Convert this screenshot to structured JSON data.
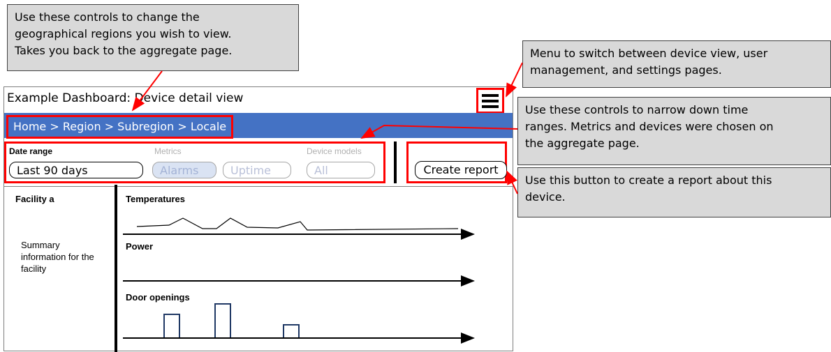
{
  "callouts": {
    "regions": [
      "Use these controls to change the",
      "geographical regions you wish to view.",
      "Takes you back to the aggregate page."
    ],
    "menu": [
      "Menu to switch between device view, user",
      "management, and settings pages."
    ],
    "time": [
      "Use these controls to narrow down time",
      "ranges.  Metrics and devices were chosen on",
      "the aggregate page."
    ],
    "report": [
      "Use this button to create a report about this",
      "device."
    ]
  },
  "dashboard": {
    "title": "Example Dashboard: Device detail view",
    "menu_icon": "hamburger-menu-icon",
    "breadcrumb": "Home > Region > Subregion > Locale",
    "filters": {
      "date_range_label": "Date range",
      "date_range_value": "Last 90 days",
      "metrics_label": "Metrics",
      "metric_alarms": "Alarms",
      "metric_uptime": "Uptime",
      "device_models_label": "Device models",
      "device_models_value": "All"
    },
    "create_report": "Create report",
    "sidebar": {
      "facility": "Facility a",
      "summary": "Summary information for the facility"
    },
    "charts": {
      "temperatures": "Temperatures",
      "power": "Power",
      "door_openings": "Door openings"
    }
  },
  "colors": {
    "breadcrumb_bar": "#4472c4",
    "highlight": "#ff0000",
    "callout": "#d9d9d9"
  }
}
